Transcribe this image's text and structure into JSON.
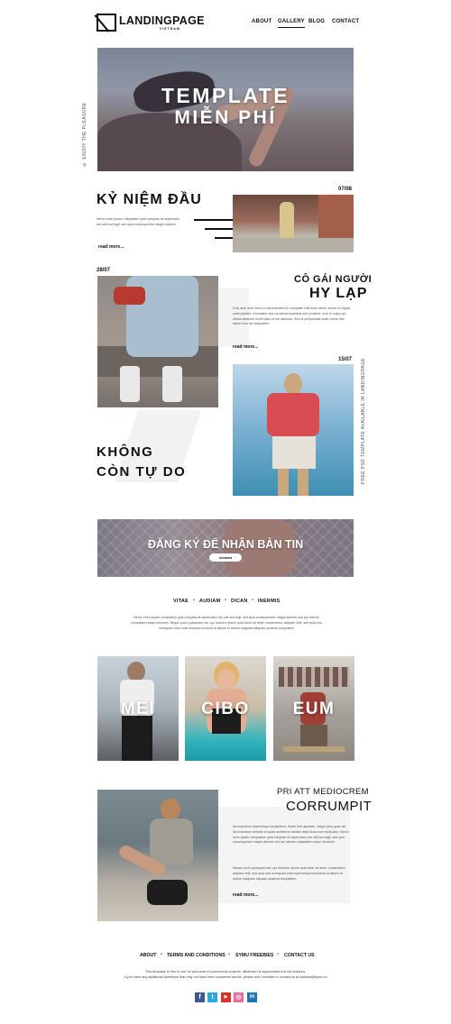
{
  "header": {
    "logo_text": "LANDINGPAGE",
    "logo_sub": "VIETNAM",
    "nav": [
      "ABOUT",
      "GALLERY",
      "BLOG",
      "CONTACT"
    ],
    "active_nav": "GALLERY"
  },
  "hero": {
    "title_line1": "TEMPLATE",
    "title_line2": "MIỄN PHÍ",
    "side_text": "ENJOY THE PLEASURE"
  },
  "post1": {
    "title": "KỶ NIỆM ĐẦU",
    "text": "Nemo enim ipsam voluptatem quia voluptas sit aspernatur aut odit aut fugit, sed quia consequuntur magni dolores",
    "read_more": "read more...",
    "date": "07/08"
  },
  "post2": {
    "date": "28/07",
    "title_line1": "CÔ GÁI NGƯỜI",
    "title_line2": "HY LẠP",
    "text": "Duis aute irure dolor in reprehenderit in voluptate velit esse cillum dolore eu fugiat nulla pariatur. Excepteur sint occaecat cupidatat non proident, sunt in culpa qui officia deserunt mollit anim id est laborum. Sed ut perspiciatis unde omnis iste natus error sit voluptatem",
    "read_more": "read more..."
  },
  "post3": {
    "date": "15/07",
    "title_line1": "KHÔNG",
    "title_line2": "CÒN TỰ DO",
    "side_text": "FREE PSD TEMPLATE AVAILABLE IN LANDINGPAGE"
  },
  "newsletter": {
    "title": "ĐĂNG KÝ ĐỂ NHẬN BẢN TIN",
    "button": "contact"
  },
  "menu2": {
    "items": [
      "VITAE",
      "AUDIAM",
      "DICAN",
      "INERMIS"
    ],
    "text": "Nemo enim ipsam voluptatem quia voluptas sit aspernatur aut odit aut fugit, sed quia consequuntur magni dolores eos qui ratione voluptatem sequi nesciunt. Neque porro quisquam est, qui dolorem ipsum quia dolor sit amet, consectetur, adipisci velit, sed quia non numquam eius modi tempora incidunt ut labore et dolore magnam aliquam quaerat voluptatem"
  },
  "gallery": {
    "items": [
      "MEI",
      "CIBO",
      "EUM"
    ]
  },
  "feature": {
    "title_line1": "PRI ATT MEDIOCREM",
    "title_line2": "CORRUMPIT",
    "para1": "Accusantium doloremque laudantium, totam rem aperiam, eaque ipsa quae ab illo inventore veritatis et quasi architecto beatae vitae dicta sunt explicabo. Nemo enim ipsam voluptatem quia voluptas sit aspernatur aut odit aut fugit, sed quia consequuntur magni dolores eos qui ratione voluptatem sequi nesciunt.",
    "para2": "Neque porro quisquam est, qui dolorem ipsum quia dolor sit amet, consectetur, adipisci velit, sed quia non numquam eius modi tempora incidunt ut labore et dolore magnam aliquam quaerat voluptatem.",
    "read_more": "read more..."
  },
  "footer": {
    "links": [
      "ABOUT",
      "TERMS AND CONDITIONS",
      "SYMU FREEBIES",
      "CONTACT US"
    ],
    "line1": "This template is free to use for personal or commercial projects, attribution is appreciated but not required.",
    "line2": "If you have any additional questions that may not have been answered above, please don't hesitate to contact us at contact@symu.co",
    "social": [
      {
        "icon": "facebook-icon",
        "glyph": "f",
        "color": "#3b5998"
      },
      {
        "icon": "twitter-icon",
        "glyph": "t",
        "color": "#2aa9e0"
      },
      {
        "icon": "youtube-icon",
        "glyph": "▶",
        "color": "#d9342b"
      },
      {
        "icon": "dribbble-icon",
        "glyph": "◎",
        "color": "#e8699b"
      },
      {
        "icon": "linkedin-icon",
        "glyph": "in",
        "color": "#1f78b4"
      }
    ]
  }
}
